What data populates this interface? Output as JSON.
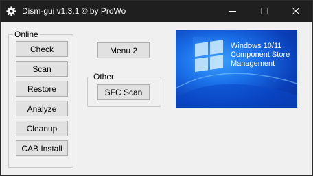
{
  "window": {
    "title": "Dism-gui v1.3.1    © by ProWo",
    "controls": {
      "minimize": "minimize",
      "maximize": "maximize",
      "close": "close"
    }
  },
  "online_group": {
    "label": "Online",
    "buttons": [
      "Check",
      "Scan",
      "Restore",
      "Analyze",
      "Cleanup",
      "CAB Install"
    ]
  },
  "menu_button": "Menu 2",
  "other_group": {
    "label": "Other",
    "sfc_button": "SFC Scan"
  },
  "banner": {
    "line1": "Windows 10/11",
    "line2": "Component Store",
    "line3": "Management"
  },
  "colors": {
    "titlebar": "#1f1f1f",
    "client": "#f0f0f0",
    "button": "#e1e1e1",
    "banner_blue": "#1a6fe8"
  },
  "icons": {
    "app": "gear-icon",
    "banner": "windows-logo-icon"
  }
}
